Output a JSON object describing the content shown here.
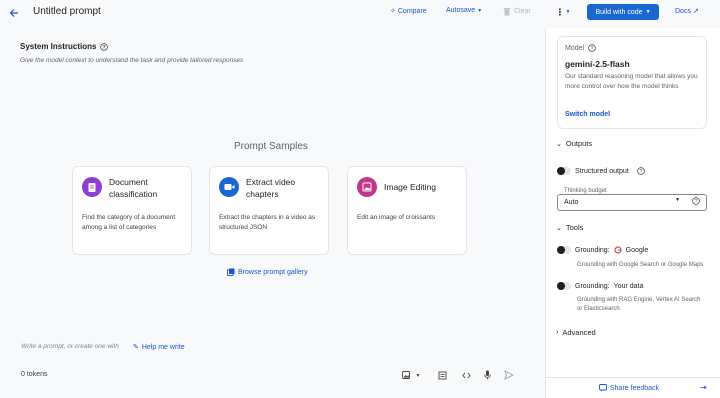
{
  "header": {
    "title": "Untitled prompt",
    "compare_label": "Compare",
    "autosave_label": "Autosave",
    "clear_label": "Clear",
    "build_label": "Build with code",
    "docs_label": "Docs"
  },
  "system": {
    "title": "System Instructions",
    "hint": "Give the model context to understand the task and provide tailored responses"
  },
  "samples": {
    "title": "Prompt Samples",
    "cards": [
      {
        "title": "Document classification",
        "desc": "Find the category of a document among a list of categories",
        "color": "#8e3ed0"
      },
      {
        "title": "Extract video chapters",
        "desc": "Extract the chapters in a video as structured JSON",
        "color": "#1a66d2"
      },
      {
        "title": "Image Editing",
        "desc": "Edit an image of croissants",
        "color": "#c2378a"
      }
    ],
    "gallery_label": "Browse prompt gallery"
  },
  "composer": {
    "placeholder": "Write a prompt, or create one with",
    "help_label": "Help me write",
    "tokens": "0 tokens"
  },
  "panel": {
    "model_label": "Model",
    "model_name": "gemini-2.5-flash",
    "model_desc": "Our standard reasoning model that allows you more control over how the model thinks",
    "switch_label": "Switch model",
    "outputs_label": "Outputs",
    "structured_label": "Structured output",
    "thinking_label": "Thinking budget",
    "thinking_value": "Auto",
    "tools_label": "Tools",
    "grounding_google_label": "Grounding:",
    "grounding_google_name": "Google",
    "grounding_google_desc": "Grounding with Google Search or Google Maps",
    "grounding_data_label": "Grounding:",
    "grounding_data_name": "Your data",
    "grounding_data_desc": "Grounding with RAG Engine, Vertex AI Search or Elasticsearch",
    "advanced_label": "Advanced",
    "share_label": "Share feedback"
  }
}
